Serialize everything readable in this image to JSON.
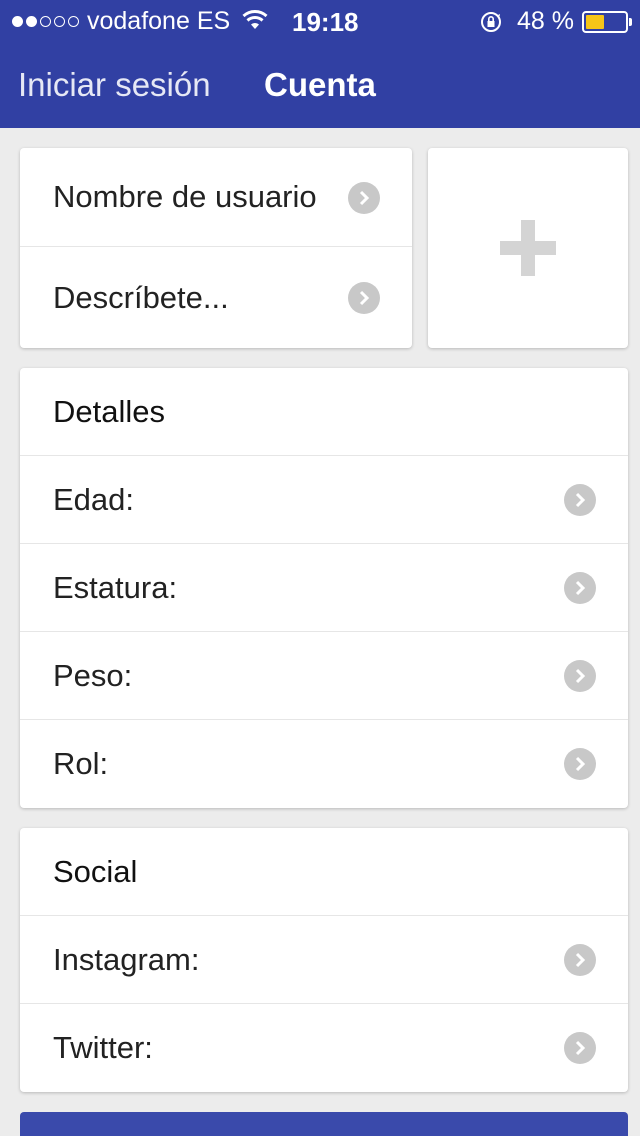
{
  "status_bar": {
    "carrier": "vodafone ES",
    "time": "19:18",
    "battery_percent": "48 %",
    "battery_level": 0.48,
    "signal_bars_filled": 2,
    "signal_bars_total": 5
  },
  "nav": {
    "login_label": "Iniciar sesión",
    "account_label": "Cuenta"
  },
  "profile": {
    "username_label": "Nombre de usuario",
    "describe_label": "Descríbete..."
  },
  "details": {
    "title": "Detalles",
    "rows": [
      {
        "label": "Edad:"
      },
      {
        "label": "Estatura:"
      },
      {
        "label": "Peso:"
      },
      {
        "label": "Rol:"
      }
    ]
  },
  "social": {
    "title": "Social",
    "rows": [
      {
        "label": "Instagram:"
      },
      {
        "label": "Twitter:"
      }
    ]
  },
  "colors": {
    "brand": "#3140a3",
    "background": "#ececec",
    "chevron": "#c8c8c8",
    "battery_fill": "#f5c518"
  }
}
